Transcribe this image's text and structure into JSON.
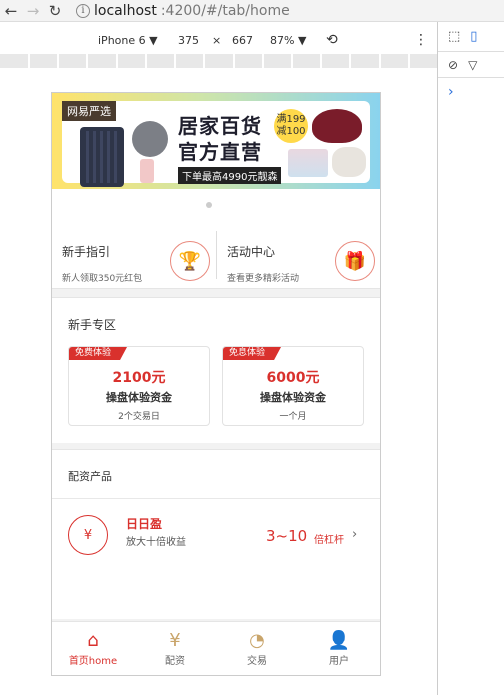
{
  "browser": {
    "url_host": "localhost",
    "url_rest": ":4200/#/tab/home"
  },
  "device_toolbar": {
    "device": "iPhone 6",
    "width": "375",
    "x": "×",
    "height": "667",
    "zoom": "87%"
  },
  "banner": {
    "logo": "网易严选",
    "title_line1": "居家百货",
    "title_line2": "官方直营",
    "badge": "满199减100",
    "subtitle": "下单最高4990元靓森"
  },
  "guides": [
    {
      "title": "新手指引",
      "subtitle": "新人领取350元红包"
    },
    {
      "title": "活动中心",
      "subtitle": "查看更多精彩活动"
    }
  ],
  "newbie": {
    "title": "新手专区",
    "cards": [
      {
        "tag": "免费体验",
        "amount": "2100元",
        "name": "操盘体验资金",
        "duration": "2个交易日"
      },
      {
        "tag": "免息体验",
        "amount": "6000元",
        "name": "操盘体验资金",
        "duration": "一个月"
      }
    ]
  },
  "products": {
    "title": "配资产品",
    "item": {
      "name": "日日盈",
      "desc": "放大十倍收益",
      "range": "3~10",
      "unit": "倍杠杆",
      "arrow": "›"
    }
  },
  "tabbar": [
    {
      "label": "首页home",
      "active": true
    },
    {
      "label": "配资",
      "active": false
    },
    {
      "label": "交易",
      "active": false
    },
    {
      "label": "用户",
      "active": false
    }
  ]
}
